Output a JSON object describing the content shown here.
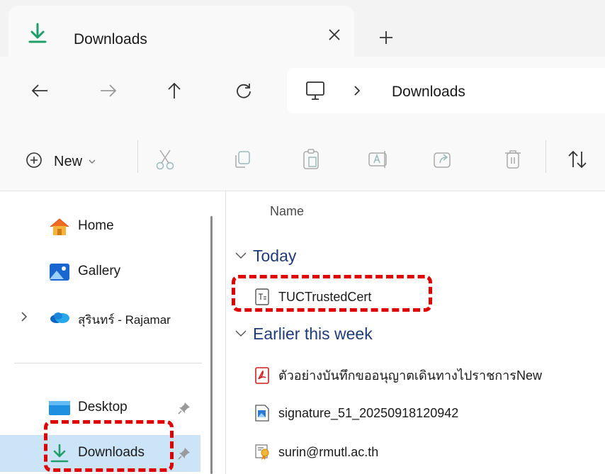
{
  "tab": {
    "title": "Downloads",
    "close_icon": "close-icon",
    "new_tab_icon": "plus-icon"
  },
  "nav": {
    "back_icon": "arrow-left-icon",
    "forward_icon": "arrow-right-icon",
    "up_icon": "arrow-up-icon",
    "refresh_icon": "refresh-icon"
  },
  "address": {
    "location_icon": "this-pc-icon",
    "separator_icon": "chevron-right-icon",
    "segment": "Downloads"
  },
  "commands": {
    "new_label": "New",
    "icons": [
      "cut-icon",
      "copy-icon",
      "paste-icon",
      "rename-icon",
      "share-icon",
      "delete-icon",
      "sort-icon"
    ]
  },
  "sidebar": {
    "items": [
      {
        "label": "Home",
        "icon": "home-icon"
      },
      {
        "label": "Gallery",
        "icon": "gallery-icon"
      },
      {
        "label": "สุรินทร์ - Rajamar",
        "icon": "onedrive-cloud-icon"
      },
      {
        "label": "Desktop",
        "icon": "desktop-folder-icon",
        "pinned": true
      },
      {
        "label": "Downloads",
        "icon": "download-icon",
        "pinned": true,
        "selected": true
      }
    ]
  },
  "filelist": {
    "column_name": "Name",
    "groups": [
      {
        "label": "Today",
        "files": [
          {
            "name": "TUCTrustedCert",
            "icon": "text-file-icon"
          }
        ]
      },
      {
        "label": "Earlier this week",
        "files": [
          {
            "name": "ตัวอย่างบันทึกขออนุญาตเดินทางไปราชการNew",
            "icon": "pdf-file-icon"
          },
          {
            "name": "signature_51_20250918120942",
            "icon": "image-file-icon"
          },
          {
            "name": "surin@rmutl.ac.th",
            "icon": "certificate-file-icon"
          }
        ]
      }
    ]
  },
  "colors": {
    "accent_download": "#1e9e6a",
    "highlight": "#e00000",
    "selected_bg": "#cce4f7",
    "group_text": "#1f3b78"
  }
}
